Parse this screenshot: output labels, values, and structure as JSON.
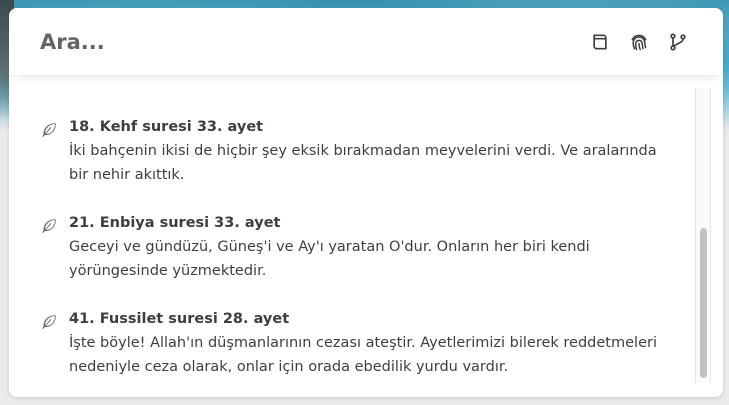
{
  "search": {
    "placeholder": "Ara..."
  },
  "toolbar": {
    "icons": [
      "book-icon",
      "fingerprint-icon",
      "git-branch-icon"
    ]
  },
  "results": [
    {
      "title": "18. Kehf suresi 33. ayet",
      "text": "İki bahçenin ikisi de hiçbir şey eksik bırakmadan meyvelerini verdi. Ve aralarında bir nehir akıttık."
    },
    {
      "title": "21. Enbiya suresi 33. ayet",
      "text": "Geceyi ve gündüzü, Güneş'i ve Ay'ı yaratan O'dur. Onların her biri kendi yörüngesinde yüzmektedir."
    },
    {
      "title": "41. Fussilet suresi 28. ayet",
      "text": "İşte böyle! Allah'ın düşmanlarının cezası ateştir. Ayetlerimizi bilerek reddetmeleri nedeniyle ceza olarak, onlar için orada ebedilik yurdu vardır."
    }
  ],
  "colors": {
    "text": "#3b3f43",
    "icon": "#5f6368",
    "panel": "#ffffff"
  }
}
